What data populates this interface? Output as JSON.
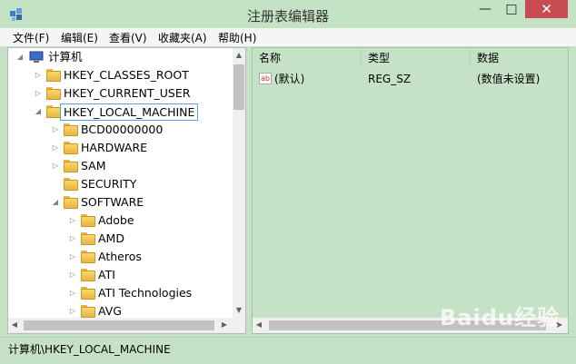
{
  "window": {
    "title": "注册表编辑器",
    "minimize": "—",
    "maximize": "□",
    "close": "✕"
  },
  "menu": [
    "文件(F)",
    "编辑(E)",
    "查看(V)",
    "收藏夹(A)",
    "帮助(H)"
  ],
  "tree": {
    "root": "计算机",
    "items": [
      {
        "label": "HKEY_CLASSES_ROOT",
        "level": 1,
        "expander": "▷"
      },
      {
        "label": "HKEY_CURRENT_USER",
        "level": 1,
        "expander": "▷"
      },
      {
        "label": "HKEY_LOCAL_MACHINE",
        "level": 1,
        "expander": "◢",
        "selected": true
      },
      {
        "label": "BCD00000000",
        "level": 2,
        "expander": "▷"
      },
      {
        "label": "HARDWARE",
        "level": 2,
        "expander": "▷"
      },
      {
        "label": "SAM",
        "level": 2,
        "expander": "▷"
      },
      {
        "label": "SECURITY",
        "level": 2,
        "expander": ""
      },
      {
        "label": "SOFTWARE",
        "level": 2,
        "expander": "◢"
      },
      {
        "label": "Adobe",
        "level": 3,
        "expander": "▷"
      },
      {
        "label": "AMD",
        "level": 3,
        "expander": "▷"
      },
      {
        "label": "Atheros",
        "level": 3,
        "expander": "▷"
      },
      {
        "label": "ATI",
        "level": 3,
        "expander": "▷"
      },
      {
        "label": "ATI Technologies",
        "level": 3,
        "expander": "▷"
      },
      {
        "label": "AVG",
        "level": 3,
        "expander": "▷"
      }
    ]
  },
  "list": {
    "columns": [
      "名称",
      "类型",
      "数据"
    ],
    "rows": [
      {
        "name": "(默认)",
        "type": "REG_SZ",
        "data": "(数值未设置)",
        "icon": "ab"
      }
    ]
  },
  "statusbar": {
    "path": "计算机\\HKEY_LOCAL_MACHINE"
  },
  "watermark": "Baidu经验",
  "colors": {
    "window_bg": "#c6e2c6",
    "close_button": "#c74b50",
    "folder": "#f2c84e",
    "selection_border": "#5aa0e0"
  }
}
